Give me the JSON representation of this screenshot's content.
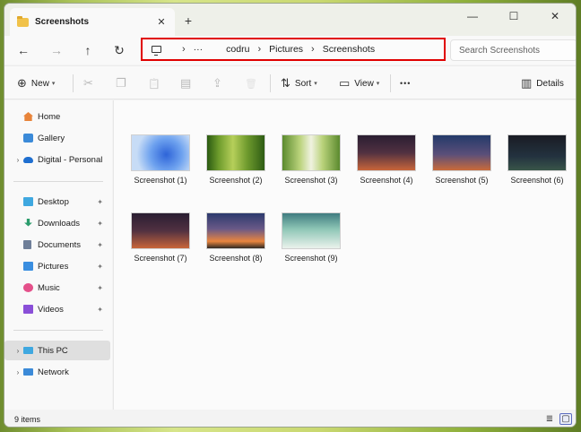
{
  "window": {
    "tab_title": "Screenshots",
    "tab_close": "✕",
    "new_tab": "+",
    "minimize": "—",
    "maximize": "☐",
    "close": "✕"
  },
  "nav": {
    "back": "←",
    "forward": "→",
    "up": "↑",
    "refresh": "↻",
    "breadcrumb": [
      "···",
      "codru",
      "Pictures",
      "Screenshots"
    ],
    "separator": "›",
    "search_placeholder": "Search Screenshots"
  },
  "toolbar": {
    "new_label": "New",
    "sort_label": "Sort",
    "view_label": "View",
    "more": "•••",
    "details_label": "Details",
    "icons": {
      "new": "⊕",
      "cut": "✂",
      "copy": "❐",
      "paste": "📋",
      "rename": "▤",
      "share": "⇪",
      "delete": "🗑",
      "sort": "⇅",
      "view": "▭",
      "details": "▥",
      "chevron": "▾"
    }
  },
  "sidebar": {
    "items": [
      {
        "label": "Home",
        "icon_color": "#e8843a"
      },
      {
        "label": "Gallery",
        "icon_color": "#3b8ad8"
      },
      {
        "label": "Digital - Personal",
        "icon_color": "#1f6fd0",
        "expander": "›"
      },
      {
        "label": "Desktop",
        "icon_color": "#3fa8e0",
        "pin": "📌"
      },
      {
        "label": "Downloads",
        "icon_color": "#2b9c6c",
        "pin": "📌"
      },
      {
        "label": "Documents",
        "icon_color": "#6f7f99",
        "pin": "📌"
      },
      {
        "label": "Pictures",
        "icon_color": "#3a8ee0",
        "pin": "📌"
      },
      {
        "label": "Music",
        "icon_color": "#e4508a",
        "pin": "📌"
      },
      {
        "label": "Videos",
        "icon_color": "#8a4fd8",
        "pin": "📌"
      },
      {
        "label": "This PC",
        "icon_color": "#3fa8e0",
        "expander": "›"
      },
      {
        "label": "Network",
        "icon_color": "#3b8ad8",
        "expander": "›"
      }
    ]
  },
  "files": [
    {
      "name": "Screenshot (1)",
      "style": "win11"
    },
    {
      "name": "Screenshot (2)",
      "style": "bamboo"
    },
    {
      "name": "Screenshot (3)",
      "style": "bamboo-light"
    },
    {
      "name": "Screenshot (4)",
      "style": "desk"
    },
    {
      "name": "Screenshot (5)",
      "style": "desk-blue"
    },
    {
      "name": "Screenshot (6)",
      "style": "dark"
    },
    {
      "name": "Screenshot (7)",
      "style": "desk"
    },
    {
      "name": "Screenshot (8)",
      "style": "sunset"
    },
    {
      "name": "Screenshot (9)",
      "style": "teal"
    }
  ],
  "status": {
    "item_count": "9 items",
    "details_view_icon": "≣",
    "tiles_view_icon": "▢"
  },
  "colors": {
    "highlight_border": "#e00000",
    "folder": "#f1c24a"
  }
}
